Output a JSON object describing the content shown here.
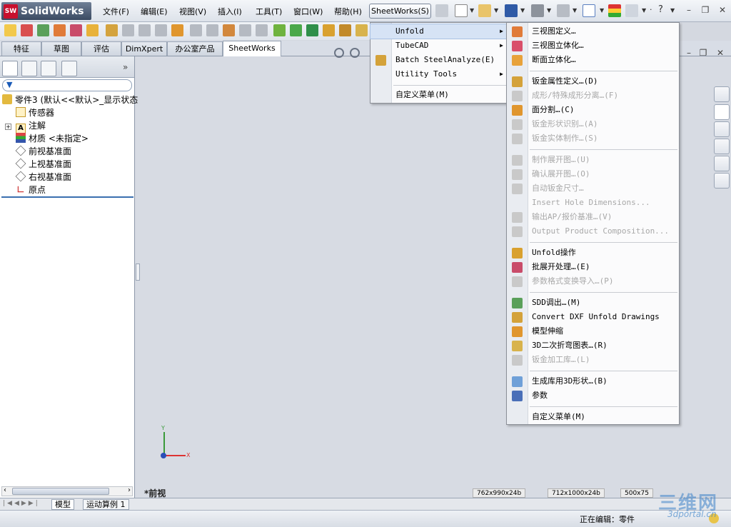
{
  "app": {
    "name": "SolidWorks",
    "logo_text": "SW"
  },
  "menubar": {
    "items": [
      "文件(F)",
      "编辑(E)",
      "视图(V)",
      "插入(I)",
      "工具(T)",
      "窗口(W)",
      "帮助(H)"
    ],
    "sheetworks": "SheetWorks(S)"
  },
  "tabs": [
    "特征",
    "草图",
    "评估",
    "DimXpert",
    "办公室产品",
    "SheetWorks"
  ],
  "active_tab": "SheetWorks",
  "tree": {
    "filter_icon": "funnel-icon",
    "root": "零件3  (默认<<默认>_显示状态",
    "items": [
      "传感器",
      "注解",
      "材质 <未指定>",
      "前视基准面",
      "上视基准面",
      "右视基准面",
      "原点"
    ]
  },
  "viewport": {
    "view_label": "*前视",
    "axis_y": "Y",
    "axis_x": "X"
  },
  "bottom_tabs": [
    "模型",
    "运动算例 1"
  ],
  "status": {
    "text": "正在编辑：零件"
  },
  "format_strip": [
    "762x990x24b",
    "712x1000x24b",
    "500x75"
  ],
  "watermark": {
    "title": "三维网",
    "url": "3dportal.cn"
  },
  "menu1": {
    "items": [
      {
        "label": "Unfold",
        "submenu": true,
        "selected": true
      },
      {
        "label": "TubeCAD",
        "submenu": true
      },
      {
        "label": "Batch SteelAnalyze(E)",
        "icon": "batch-steel-icon"
      },
      {
        "label": "Utility Tools",
        "submenu": true
      },
      {
        "label": "自定义菜单(M)"
      }
    ]
  },
  "menu2": {
    "items": [
      {
        "label": "三视图定义…",
        "icon": "three-view-define-icon",
        "enabled": true
      },
      {
        "label": "三视图立体化…",
        "icon": "three-view-solid-icon",
        "enabled": true
      },
      {
        "label": "断面立体化…",
        "icon": "section-solid-icon",
        "enabled": true
      },
      {
        "label": "钣金属性定义…(D)",
        "icon": "sheetmetal-property-icon",
        "enabled": true
      },
      {
        "label": "成形/特殊成形分离…(F)",
        "icon": "form-separate-icon",
        "enabled": false
      },
      {
        "label": "面分割…(C)",
        "icon": "face-split-icon",
        "enabled": true
      },
      {
        "label": "钣金形状识别…(A)",
        "icon": "shape-recognize-icon",
        "enabled": false
      },
      {
        "label": "钣金实体制作…(S)",
        "icon": "solid-make-icon",
        "enabled": false
      },
      {
        "label": "制作展开图…(U)",
        "icon": "make-unfold-icon",
        "enabled": false
      },
      {
        "label": "确认展开图…(O)",
        "icon": "confirm-unfold-icon",
        "enabled": false
      },
      {
        "label": "自动钣金尺寸…",
        "icon": "auto-dimension-icon",
        "enabled": false
      },
      {
        "label": "Insert Hole Dimensions...",
        "icon": "hole-dimension-icon",
        "enabled": false
      },
      {
        "label": "输出AP/报价基准…(V)",
        "icon": "output-ap-icon",
        "enabled": false
      },
      {
        "label": "Output Product Composition...",
        "icon": "product-composition-icon",
        "enabled": false
      },
      {
        "label": "Unfold操作",
        "icon": "unfold-operation-icon",
        "enabled": true
      },
      {
        "label": "批展开处理…(E)",
        "icon": "batch-unfold-icon",
        "enabled": true
      },
      {
        "label": "参数格式变换导入…(P)",
        "icon": "param-import-icon",
        "enabled": false
      },
      {
        "label": "SDD调出…(M)",
        "icon": "sdd-icon",
        "enabled": true
      },
      {
        "label": "Convert DXF Unfold Drawings",
        "icon": "dxf-convert-icon",
        "enabled": true
      },
      {
        "label": "模型伸缩",
        "icon": "model-scale-icon",
        "enabled": true
      },
      {
        "label": "3D二次折弯图表…(R)",
        "icon": "bend-chart-icon",
        "enabled": true
      },
      {
        "label": "钣金加工库…(L)",
        "icon": "process-library-icon",
        "enabled": false
      },
      {
        "label": "生成库用3D形状…(B)",
        "icon": "library-3d-icon",
        "enabled": true
      },
      {
        "label": "参数",
        "icon": "parameters-icon",
        "enabled": true
      },
      {
        "label": "自定义菜单(M)",
        "enabled": true
      }
    ]
  },
  "colors": {
    "menu_selected": "#d6e3f5",
    "disabled_text": "#a8a8a8",
    "accent": "#3a6fb0"
  }
}
